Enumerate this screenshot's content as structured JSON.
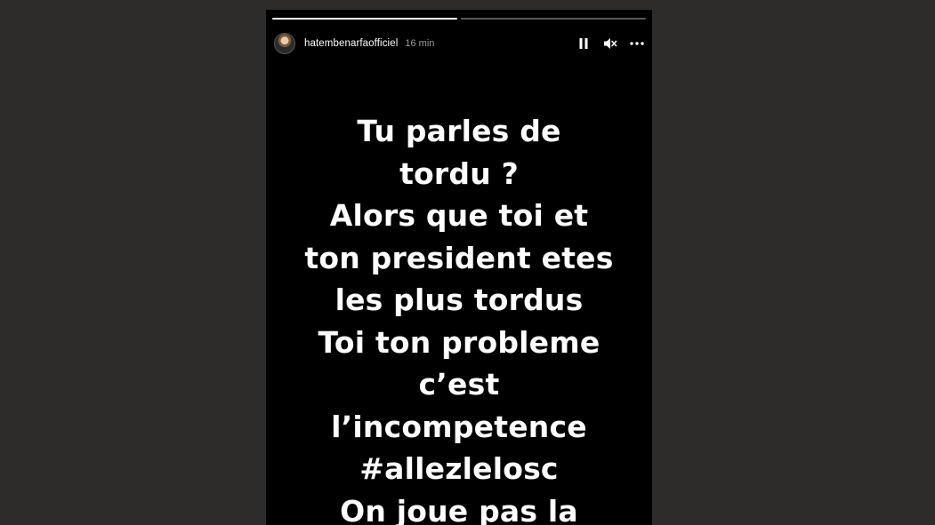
{
  "story": {
    "progress": [
      {
        "fill_fraction": 1.0
      },
      {
        "fill_fraction": 0.0
      }
    ],
    "header": {
      "username": "hatembenarfaofficiel",
      "timestamp": "16 min",
      "avatar_icon": "user-avatar",
      "controls": [
        {
          "name": "pause-icon"
        },
        {
          "name": "mute-icon"
        },
        {
          "name": "more-options-icon"
        }
      ]
    },
    "text_lines": [
      "Tu parles de",
      "tordu ?",
      "Alors que toi et",
      "ton president etes",
      "les plus tordus",
      "Toi ton probleme",
      "c’est",
      "l’incompetence",
      "#allezlelosc",
      "On joue pas la"
    ]
  },
  "colors": {
    "backdrop": "#2d2c2b",
    "story_background": "#000000",
    "text": "#ffffff"
  }
}
